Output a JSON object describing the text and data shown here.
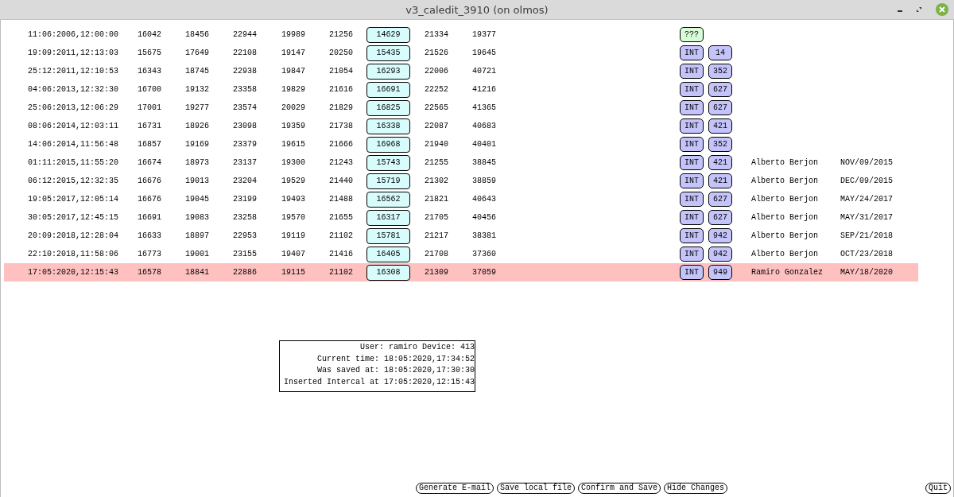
{
  "window": {
    "title": "v3_caledit_3910 (on olmos)"
  },
  "rows": [
    {
      "timestamp": "11:06:2006,12:00:00",
      "values": [
        "16042",
        "18456",
        "22944",
        "19989",
        "21256"
      ],
      "boxed_value": "14629",
      "more_values": [
        "21334",
        "19377"
      ],
      "badges": [
        {
          "label": "???",
          "kind": "unknown"
        }
      ],
      "selected": false
    },
    {
      "timestamp": "19:09:2011,12:13:03",
      "values": [
        "15675",
        "17649",
        "22108",
        "19147",
        "20250"
      ],
      "boxed_value": "15435",
      "more_values": [
        "21526",
        "19645"
      ],
      "badges": [
        {
          "label": "INT",
          "kind": "int"
        },
        {
          "label": "14",
          "kind": "int"
        }
      ],
      "selected": false
    },
    {
      "timestamp": "25:12:2011,12:10:53",
      "values": [
        "16343",
        "18745",
        "22938",
        "19847",
        "21054"
      ],
      "boxed_value": "16293",
      "more_values": [
        "22006",
        "40721"
      ],
      "badges": [
        {
          "label": "INT",
          "kind": "int"
        },
        {
          "label": "352",
          "kind": "int"
        }
      ],
      "selected": false
    },
    {
      "timestamp": "04:06:2013,12:32:30",
      "values": [
        "16700",
        "19132",
        "23358",
        "19829",
        "21616"
      ],
      "boxed_value": "16691",
      "more_values": [
        "22252",
        "41216"
      ],
      "badges": [
        {
          "label": "INT",
          "kind": "int"
        },
        {
          "label": "627",
          "kind": "int"
        }
      ],
      "selected": false
    },
    {
      "timestamp": "25:06:2013,12:06:29",
      "values": [
        "17001",
        "19277",
        "23574",
        "20029",
        "21829"
      ],
      "boxed_value": "16825",
      "more_values": [
        "22565",
        "41365"
      ],
      "badges": [
        {
          "label": "INT",
          "kind": "int"
        },
        {
          "label": "627",
          "kind": "int"
        }
      ],
      "selected": false
    },
    {
      "timestamp": "08:06:2014,12:03:11",
      "values": [
        "16731",
        "18926",
        "23098",
        "19359",
        "21738"
      ],
      "boxed_value": "16338",
      "more_values": [
        "22087",
        "40683"
      ],
      "badges": [
        {
          "label": "INT",
          "kind": "int"
        },
        {
          "label": "421",
          "kind": "int"
        }
      ],
      "selected": false
    },
    {
      "timestamp": "14:06:2014,11:56:48",
      "values": [
        "16857",
        "19169",
        "23379",
        "19615",
        "21666"
      ],
      "boxed_value": "16968",
      "more_values": [
        "21940",
        "40401"
      ],
      "badges": [
        {
          "label": "INT",
          "kind": "int"
        },
        {
          "label": "352",
          "kind": "int"
        }
      ],
      "selected": false
    },
    {
      "timestamp": "01:11:2015,11:55:20",
      "values": [
        "16674",
        "18973",
        "23137",
        "19300",
        "21243"
      ],
      "boxed_value": "15743",
      "more_values": [
        "21255",
        "38845"
      ],
      "badges": [
        {
          "label": "INT",
          "kind": "int"
        },
        {
          "label": "421",
          "kind": "int"
        }
      ],
      "editor": "Alberto Berjon",
      "edit_date": "NOV/09/2015",
      "selected": false
    },
    {
      "timestamp": "06:12:2015,12:32:35",
      "values": [
        "16676",
        "19013",
        "23204",
        "19529",
        "21440"
      ],
      "boxed_value": "15719",
      "more_values": [
        "21302",
        "38859"
      ],
      "badges": [
        {
          "label": "INT",
          "kind": "int"
        },
        {
          "label": "421",
          "kind": "int"
        }
      ],
      "editor": "Alberto Berjon",
      "edit_date": "DEC/09/2015",
      "selected": false
    },
    {
      "timestamp": "19:05:2017,12:05:14",
      "values": [
        "16676",
        "19045",
        "23199",
        "19493",
        "21488"
      ],
      "boxed_value": "16562",
      "more_values": [
        "21821",
        "40643"
      ],
      "badges": [
        {
          "label": "INT",
          "kind": "int"
        },
        {
          "label": "627",
          "kind": "int"
        }
      ],
      "editor": "Alberto Berjon",
      "edit_date": "MAY/24/2017",
      "selected": false
    },
    {
      "timestamp": "30:05:2017,12:45:15",
      "values": [
        "16691",
        "19083",
        "23258",
        "19570",
        "21655"
      ],
      "boxed_value": "16317",
      "more_values": [
        "21705",
        "40456"
      ],
      "badges": [
        {
          "label": "INT",
          "kind": "int"
        },
        {
          "label": "627",
          "kind": "int"
        }
      ],
      "editor": "Alberto Berjon",
      "edit_date": "MAY/31/2017",
      "selected": false
    },
    {
      "timestamp": "20:09:2018,12:28:04",
      "values": [
        "16633",
        "18897",
        "22953",
        "19119",
        "21102"
      ],
      "boxed_value": "15781",
      "more_values": [
        "21217",
        "38381"
      ],
      "badges": [
        {
          "label": "INT",
          "kind": "int"
        },
        {
          "label": "942",
          "kind": "int"
        }
      ],
      "editor": "Alberto Berjon",
      "edit_date": "SEP/21/2018",
      "selected": false
    },
    {
      "timestamp": "22:10:2018,11:58:06",
      "values": [
        "16773",
        "19001",
        "23155",
        "19407",
        "21416"
      ],
      "boxed_value": "16405",
      "more_values": [
        "21708",
        "37360"
      ],
      "badges": [
        {
          "label": "INT",
          "kind": "int"
        },
        {
          "label": "942",
          "kind": "int"
        }
      ],
      "editor": "Alberto Berjon",
      "edit_date": "OCT/23/2018",
      "selected": false
    },
    {
      "timestamp": "17:05:2020,12:15:43",
      "values": [
        "16578",
        "18841",
        "22886",
        "19115",
        "21102"
      ],
      "boxed_value": "16308",
      "more_values": [
        "21309",
        "37059"
      ],
      "badges": [
        {
          "label": "INT",
          "kind": "int"
        },
        {
          "label": "949",
          "kind": "int"
        }
      ],
      "editor": "Ramiro Gonzalez",
      "edit_date": "MAY/18/2020",
      "selected": true
    }
  ],
  "info_box": [
    "User: ramiro Device: 413",
    "Current time: 18:05:2020,17:34:52",
    "Was saved at: 18:05:2020,17:30:30",
    "Inserted Intercal at 17:05:2020,12:15:43"
  ],
  "buttons": [
    "Generate E-mail",
    "Save local file",
    "Confirm and Save",
    "Hide Changes"
  ],
  "quit_button": "Quit"
}
